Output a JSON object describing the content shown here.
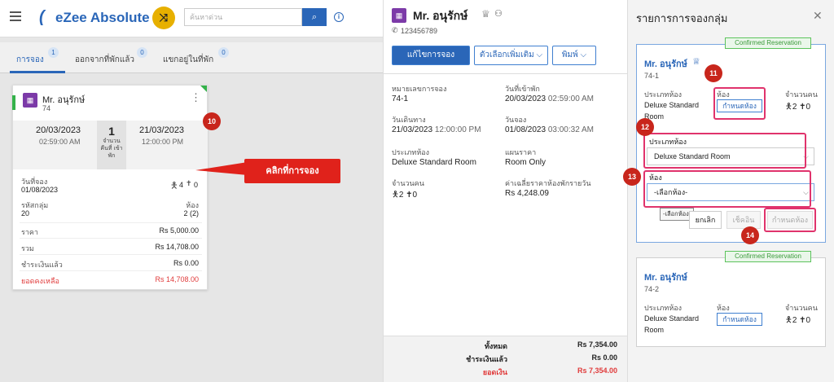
{
  "app": {
    "title": "eZee Absolute",
    "search_placeholder": "ค้นหาด่วน",
    "brand_color": "#2a66b8",
    "accent": "#e7b000"
  },
  "tabs": [
    {
      "label": "การจอง",
      "count": "1"
    },
    {
      "label": "ออกจากที่พักแล้ว",
      "count": "0"
    },
    {
      "label": "แขกอยู่ในที่พัก",
      "count": "0"
    }
  ],
  "card": {
    "guest": "Mr. อนุรักษ์",
    "room": "74",
    "arrival_date": "20/03/2023",
    "arrival_time": "02:59:00 AM",
    "nights": "1",
    "nights_label": "จำนวน คืนที่ เข้าพัก",
    "departure_date": "21/03/2023",
    "departure_time": "12:00:00 PM",
    "booking_date_label": "วันที่จอง",
    "booking_date": "01/08/2023",
    "adults": "4",
    "children": "0",
    "group_label": "รหัสกลุ่ม",
    "group_value": "20",
    "rooms_label": "ห้อง",
    "rooms_value": "2 (2)",
    "rate_label": "ราคา",
    "rate_value": "Rs 5,000.00",
    "total_label": "รวม",
    "total_value": "Rs 14,708.00",
    "paid_label": "ชำระเงินแล้ว",
    "paid_value": "Rs 0.00",
    "balance_label": "ยอดคงเหลือ",
    "balance_value": "Rs 14,708.00"
  },
  "annotations": {
    "m10": "10",
    "m11": "11",
    "m12": "12",
    "m13": "13",
    "m14": "14",
    "click_label": "คลิกที่การจอง"
  },
  "mid": {
    "guest": "Mr. อนุรักษ์",
    "phone": "123456789",
    "edit_btn": "แก้ไขการจอง",
    "more_btn": "ตัวเลือกเพิ่มเติม",
    "print_btn": "พิมพ์",
    "res_no_label": "หมายเลขการจอง",
    "res_no": "74-1",
    "checkin_label": "วันที่เข้าพัก",
    "checkin": "20/03/2023",
    "checkin_time": "02:59:00 AM",
    "depart_label": "วันเดินทาง",
    "depart": "21/03/2023",
    "depart_time": "12:00:00 PM",
    "booked_label": "วันจอง",
    "booked": "01/08/2023",
    "booked_time": "03:00:32 AM",
    "roomtype_label": "ประเภทห้อง",
    "roomtype": "Deluxe Standard Room",
    "plan_label": "แผนราคา",
    "plan": "Room Only",
    "pax_label": "จำนวนคน",
    "adults": "2",
    "children": "0",
    "avg_label": "ค่าเฉลี่ยราคาห้องพักรายวัน",
    "avg": "Rs 4,248.09",
    "sum_total_label": "ทั้งหมด",
    "sum_total": "Rs 7,354.00",
    "sum_paid_label": "ชำระเงินแล้ว",
    "sum_paid": "Rs 0.00",
    "sum_balance_label": "ยอดเงิน",
    "sum_balance": "Rs 7,354.00"
  },
  "right": {
    "title": "รายการการจองกลุ่ม",
    "confirmed": "Confirmed Reservation",
    "r1": {
      "guest": "Mr. อนุรักษ์",
      "no": "74-1",
      "rt_label": "ประเภทห้อง",
      "rt": "Deluxe Standard Room",
      "room_label": "ห้อง",
      "assign": "กำหนดห้อง",
      "pax_label": "จำนวนคน",
      "adults": "2",
      "children": "0"
    },
    "form": {
      "rt_label": "ประเภทห้อง",
      "rt_value": "Deluxe Standard Room",
      "room_label": "ห้อง",
      "room_value": "-เลือกห้อง-",
      "tooltip": "-เลือกห้อง-",
      "cancel": "ยกเลิก",
      "checkin": "เช็คอิน",
      "assign": "กำหนดห้อง"
    },
    "r2": {
      "guest": "Mr. อนุรักษ์",
      "no": "74-2",
      "rt_label": "ประเภทห้อง",
      "rt": "Deluxe Standard Room",
      "room_label": "ห้อง",
      "assign": "กำหนดห้อง",
      "pax_label": "จำนวนคน",
      "adults": "2",
      "children": "0"
    }
  }
}
